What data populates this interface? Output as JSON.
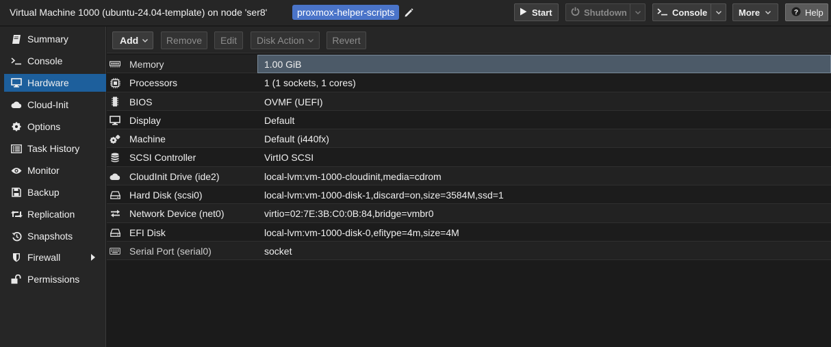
{
  "header": {
    "title": "Virtual Machine 1000 (ubuntu-24.04-template) on node 'ser8'",
    "tag": "proxmox-helper-scripts",
    "edit_icon": "pencil-icon",
    "buttons": {
      "start": "Start",
      "shutdown": "Shutdown",
      "console": "Console",
      "more": "More",
      "help": "Help"
    }
  },
  "sidebar": {
    "items": [
      {
        "label": "Summary",
        "icon": "book-icon"
      },
      {
        "label": "Console",
        "icon": "terminal-icon"
      },
      {
        "label": "Hardware",
        "icon": "monitor-icon",
        "active": true
      },
      {
        "label": "Cloud-Init",
        "icon": "cloud-icon"
      },
      {
        "label": "Options",
        "icon": "gear-icon"
      },
      {
        "label": "Task History",
        "icon": "list-icon"
      },
      {
        "label": "Monitor",
        "icon": "eye-icon"
      },
      {
        "label": "Backup",
        "icon": "floppy-icon"
      },
      {
        "label": "Replication",
        "icon": "retweet-icon"
      },
      {
        "label": "Snapshots",
        "icon": "history-icon"
      },
      {
        "label": "Firewall",
        "icon": "shield-icon"
      },
      {
        "label": "Permissions",
        "icon": "unlock-icon"
      }
    ]
  },
  "toolbar": {
    "add": "Add",
    "remove": "Remove",
    "edit": "Edit",
    "disk_action": "Disk Action",
    "revert": "Revert"
  },
  "hardware": [
    {
      "key": "Memory",
      "value": "1.00 GiB",
      "icon": "memory-icon",
      "selected": true
    },
    {
      "key": "Processors",
      "value": "1 (1 sockets, 1 cores)",
      "icon": "cpu-icon"
    },
    {
      "key": "BIOS",
      "value": "OVMF (UEFI)",
      "icon": "microchip-icon"
    },
    {
      "key": "Display",
      "value": "Default",
      "icon": "desktop-icon"
    },
    {
      "key": "Machine",
      "value": "Default (i440fx)",
      "icon": "cogs-icon"
    },
    {
      "key": "SCSI Controller",
      "value": "VirtIO SCSI",
      "icon": "database-icon"
    },
    {
      "key": "CloudInit Drive (ide2)",
      "value": "local-lvm:vm-1000-cloudinit,media=cdrom",
      "icon": "cloud-icon"
    },
    {
      "key": "Hard Disk (scsi0)",
      "value": "local-lvm:vm-1000-disk-1,discard=on,size=3584M,ssd=1",
      "icon": "hdd-icon"
    },
    {
      "key": "Network Device (net0)",
      "value": "virtio=02:7E:3B:C0:0B:84,bridge=vmbr0",
      "icon": "exchange-icon"
    },
    {
      "key": "EFI Disk",
      "value": "local-lvm:vm-1000-disk-0,efitype=4m,size=4M",
      "icon": "hdd-icon"
    },
    {
      "key": "Serial Port (serial0)",
      "value": "socket",
      "icon": "keyboard-icon",
      "dim": true
    }
  ]
}
